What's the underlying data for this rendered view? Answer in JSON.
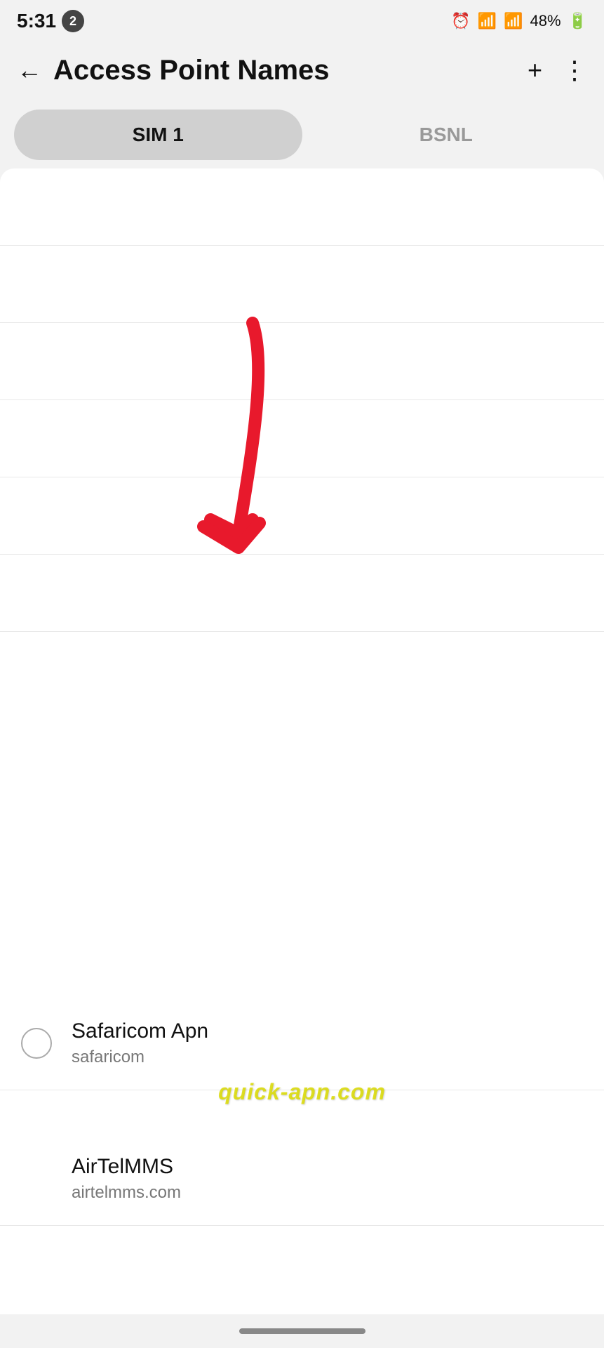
{
  "status_bar": {
    "time": "5:31",
    "notification_count": "2",
    "battery_percent": "48%"
  },
  "header": {
    "title": "Access Point Names",
    "back_icon": "←",
    "add_icon": "+",
    "more_icon": "⋮"
  },
  "sim_tabs": [
    {
      "id": "sim1",
      "label": "SIM 1",
      "active": true
    },
    {
      "id": "bsnl",
      "label": "BSNL",
      "active": false
    }
  ],
  "apn_items": [
    {
      "id": "safaricom",
      "name": "Safaricom Apn",
      "address": "safaricom",
      "selected": false
    },
    {
      "id": "airtelmms",
      "name": "AirTelMMS",
      "address": "airtelmms.com",
      "selected": false
    }
  ],
  "watermark": {
    "text": "quick-apn.com"
  },
  "bottom_bar": {
    "home_indicator": ""
  }
}
